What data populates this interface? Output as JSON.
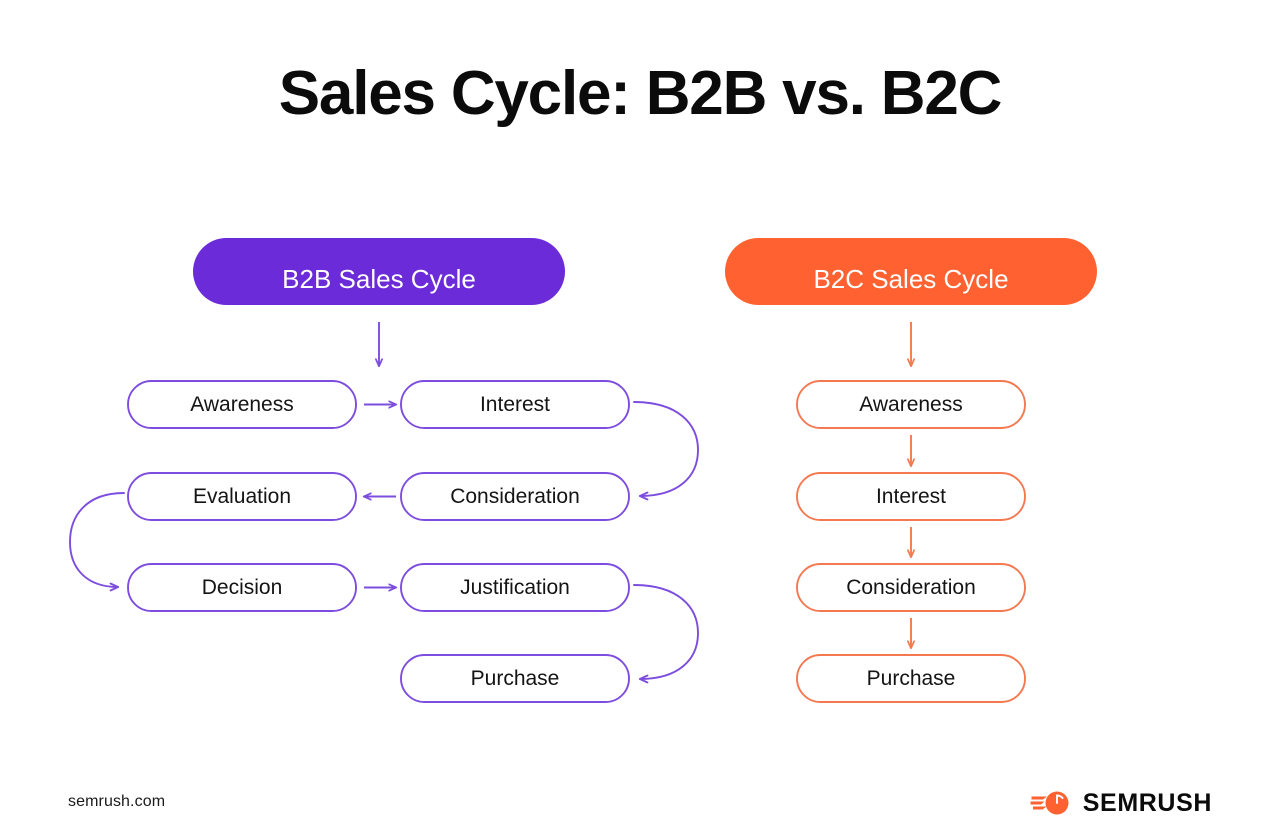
{
  "title": "Sales Cycle: B2B vs. B2C",
  "background_color": "#ffffff",
  "colors": {
    "b2b_purple": "#6c2bd9",
    "b2b_line": "#7c4dde",
    "b2c_orange": "#ff6230",
    "b2c_line": "#f47950",
    "text_dark": "#141414"
  },
  "columns": {
    "b2b": {
      "header": "B2B Sales Cycle",
      "nodes": [
        {
          "id": "b2b-awareness",
          "label": "Awareness"
        },
        {
          "id": "b2b-interest",
          "label": "Interest"
        },
        {
          "id": "b2b-consideration",
          "label": "Consideration"
        },
        {
          "id": "b2b-evaluation",
          "label": "Evaluation"
        },
        {
          "id": "b2b-decision",
          "label": "Decision"
        },
        {
          "id": "b2b-justification",
          "label": "Justification"
        },
        {
          "id": "b2b-purchase",
          "label": "Purchase"
        }
      ],
      "flow_order": [
        "Awareness",
        "Interest",
        "Consideration",
        "Evaluation",
        "Decision",
        "Justification",
        "Purchase"
      ]
    },
    "b2c": {
      "header": "B2C Sales Cycle",
      "nodes": [
        {
          "id": "b2c-awareness",
          "label": "Awareness"
        },
        {
          "id": "b2c-interest",
          "label": "Interest"
        },
        {
          "id": "b2c-consideration",
          "label": "Consideration"
        },
        {
          "id": "b2c-purchase",
          "label": "Purchase"
        }
      ],
      "flow_order": [
        "Awareness",
        "Interest",
        "Consideration",
        "Purchase"
      ]
    }
  },
  "footer": {
    "url": "semrush.com",
    "logo_text": "SEMRUSH",
    "logo_icon": "semrush-comet-icon"
  }
}
